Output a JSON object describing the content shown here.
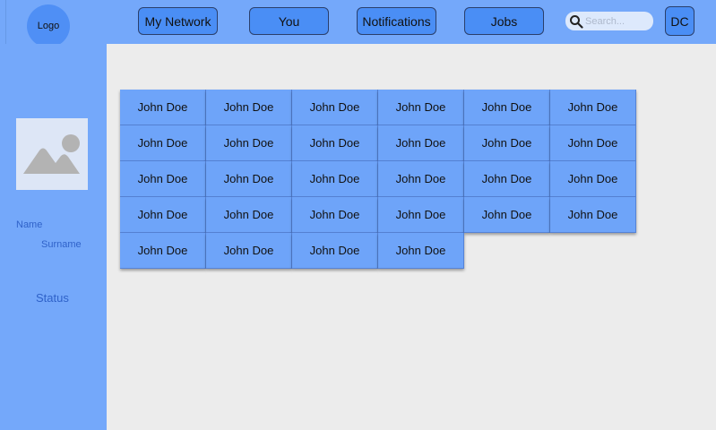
{
  "header": {
    "logo_label": "Logo",
    "nav": [
      "My Network",
      "You",
      "Notifications",
      "Jobs"
    ],
    "search_placeholder": "Search...",
    "user_initials": "DC"
  },
  "sidebar": {
    "name_label": "Name",
    "surname_label": "Surname",
    "status_label": "Status"
  },
  "connections": [
    "John Doe",
    "John Doe",
    "John Doe",
    "John Doe",
    "John Doe",
    "John Doe",
    "John Doe",
    "John Doe",
    "John Doe",
    "John Doe",
    "John Doe",
    "John Doe",
    "John Doe",
    "John Doe",
    "John Doe",
    "John Doe",
    "John Doe",
    "John Doe",
    "John Doe",
    "John Doe",
    "John Doe",
    "John Doe",
    "John Doe",
    "John Doe",
    "John Doe",
    "John Doe",
    "John Doe",
    "John Doe"
  ]
}
